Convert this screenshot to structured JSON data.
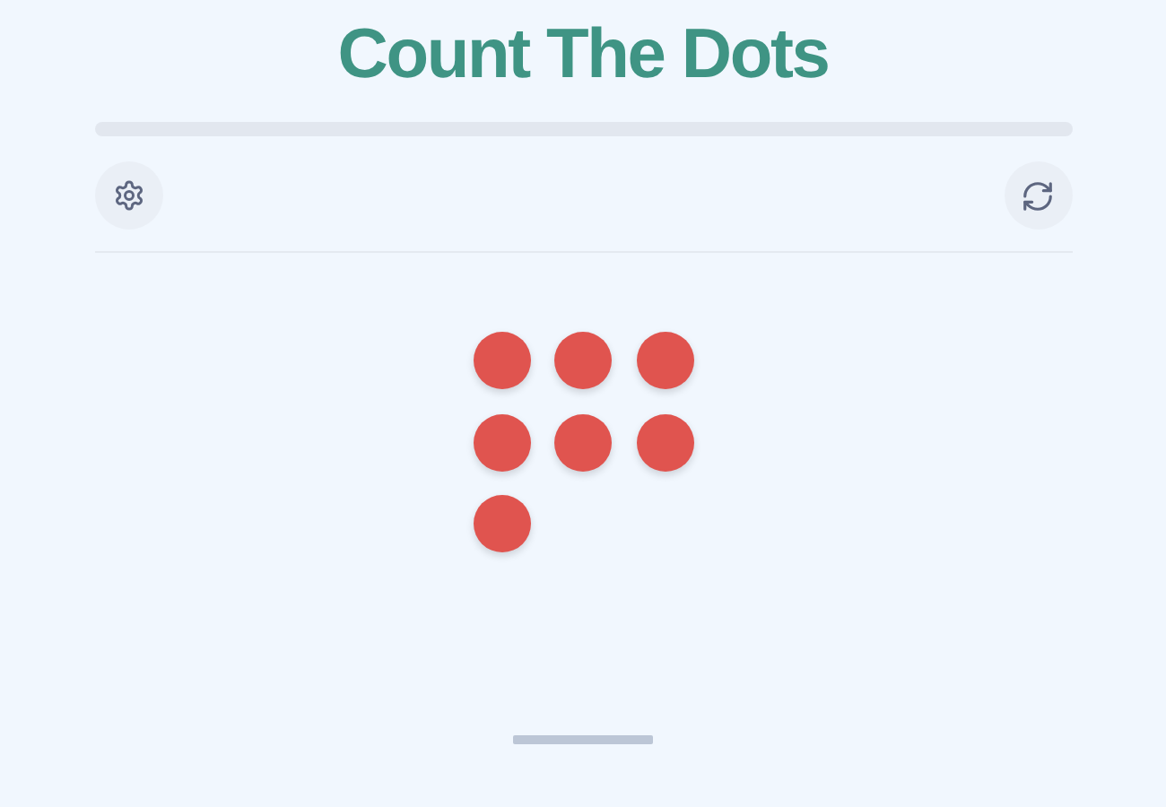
{
  "title": "Count The Dots",
  "progress": {
    "level": 0
  },
  "dots": [
    {
      "kind": "dot"
    },
    {
      "kind": "dot"
    },
    {
      "kind": "dot"
    },
    {
      "kind": "dot"
    },
    {
      "kind": "dot"
    },
    {
      "kind": "dot"
    },
    {
      "kind": "dot"
    }
  ]
}
